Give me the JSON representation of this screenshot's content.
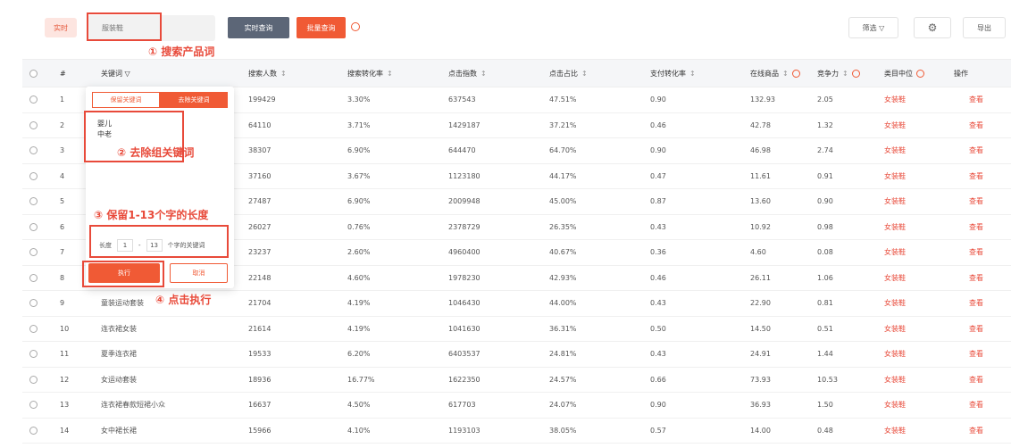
{
  "toolbar": {
    "all_btn": "实时",
    "search_placeholder": "服装鞋",
    "query_btn": "实时查询",
    "export_query_btn": "批量查询",
    "filter_btn": "筛选 ▽",
    "settings_icon": "gear-icon",
    "export_btn": "导出"
  },
  "annotations": {
    "a1": "① 搜索产品词",
    "a2": "② 去除组关键词",
    "a3": "③ 保留1-13个字的长度",
    "a4": "④ 点击执行"
  },
  "table": {
    "headers": {
      "num": "#",
      "keyword": "关键词 ▽",
      "searchers": "搜索人数",
      "conversion": "搜索转化率",
      "clicks": "点击指数",
      "click_rate": "点击占比",
      "pay_rate": "支付转化率",
      "supply": "在线商品",
      "competition": "竞争力",
      "category": "类目中位",
      "action": "操作"
    },
    "sort_glyph": "↕",
    "rows": [
      {
        "n": "1",
        "kw": "",
        "s": "199429",
        "c": "3.30%",
        "k": "637543",
        "r": "47.51%",
        "p": "0.90",
        "g": "132.93",
        "m": "2.05",
        "t": "女装鞋",
        "a": "查看"
      },
      {
        "n": "2",
        "kw": "",
        "s": "64110",
        "c": "3.71%",
        "k": "1429187",
        "r": "37.21%",
        "p": "0.46",
        "g": "42.78",
        "m": "1.32",
        "t": "女装鞋",
        "a": "查看"
      },
      {
        "n": "3",
        "kw": "",
        "s": "38307",
        "c": "6.90%",
        "k": "644470",
        "r": "64.70%",
        "p": "0.90",
        "g": "46.98",
        "m": "2.74",
        "t": "女装鞋",
        "a": "查看"
      },
      {
        "n": "4",
        "kw": "",
        "s": "37160",
        "c": "3.67%",
        "k": "1123180",
        "r": "44.17%",
        "p": "0.47",
        "g": "11.61",
        "m": "0.91",
        "t": "女装鞋",
        "a": "查看"
      },
      {
        "n": "5",
        "kw": "",
        "s": "27487",
        "c": "6.90%",
        "k": "2009948",
        "r": "45.00%",
        "p": "0.87",
        "g": "13.60",
        "m": "0.90",
        "t": "女装鞋",
        "a": "查看"
      },
      {
        "n": "6",
        "kw": "",
        "s": "26027",
        "c": "0.76%",
        "k": "2378729",
        "r": "26.35%",
        "p": "0.43",
        "g": "10.92",
        "m": "0.98",
        "t": "女装鞋",
        "a": "查看"
      },
      {
        "n": "7",
        "kw": "",
        "s": "23237",
        "c": "2.60%",
        "k": "4960400",
        "r": "40.67%",
        "p": "0.36",
        "g": "4.60",
        "m": "0.08",
        "t": "女装鞋",
        "a": "查看"
      },
      {
        "n": "8",
        "kw": "",
        "s": "22148",
        "c": "4.60%",
        "k": "1978230",
        "r": "42.93%",
        "p": "0.46",
        "g": "26.11",
        "m": "1.06",
        "t": "女装鞋",
        "a": "查看"
      },
      {
        "n": "9",
        "kw": "童装运动套装",
        "s": "21704",
        "c": "4.19%",
        "k": "1046430",
        "r": "44.00%",
        "p": "0.43",
        "g": "22.90",
        "m": "0.81",
        "t": "女装鞋",
        "a": "查看"
      },
      {
        "n": "10",
        "kw": "连衣裙女装",
        "s": "21614",
        "c": "4.19%",
        "k": "1041630",
        "r": "36.31%",
        "p": "0.50",
        "g": "14.50",
        "m": "0.51",
        "t": "女装鞋",
        "a": "查看"
      },
      {
        "n": "11",
        "kw": "夏季连衣裙",
        "s": "19533",
        "c": "6.20%",
        "k": "6403537",
        "r": "24.81%",
        "p": "0.43",
        "g": "24.91",
        "m": "1.44",
        "t": "女装鞋",
        "a": "查看"
      },
      {
        "n": "12",
        "kw": "女运动套装",
        "s": "18936",
        "c": "16.77%",
        "k": "1622350",
        "r": "24.57%",
        "p": "0.66",
        "g": "73.93",
        "m": "10.53",
        "t": "女装鞋",
        "a": "查看"
      },
      {
        "n": "13",
        "kw": "连衣裙春款短裙小众",
        "s": "16637",
        "c": "4.50%",
        "k": "617703",
        "r": "24.07%",
        "p": "0.90",
        "g": "36.93",
        "m": "1.50",
        "t": "女装鞋",
        "a": "查看"
      },
      {
        "n": "14",
        "kw": "女中裙长裙",
        "s": "15966",
        "c": "4.10%",
        "k": "1193103",
        "r": "38.05%",
        "p": "0.57",
        "g": "14.00",
        "m": "0.48",
        "t": "女装鞋",
        "a": "查看"
      }
    ]
  },
  "popup": {
    "tab_a": "保留关键词",
    "tab_b": "去除关键词",
    "words": [
      "婴儿",
      "中老"
    ],
    "len_prefix": "长度",
    "len_min": "1",
    "len_sep": "-",
    "len_max": "13",
    "len_suffix": "个字的关键词",
    "exec": "执行",
    "cancel": "取消"
  },
  "colors": {
    "accent": "#f05a35",
    "annotation": "#e84a3a",
    "dark_button": "#5c6677"
  }
}
